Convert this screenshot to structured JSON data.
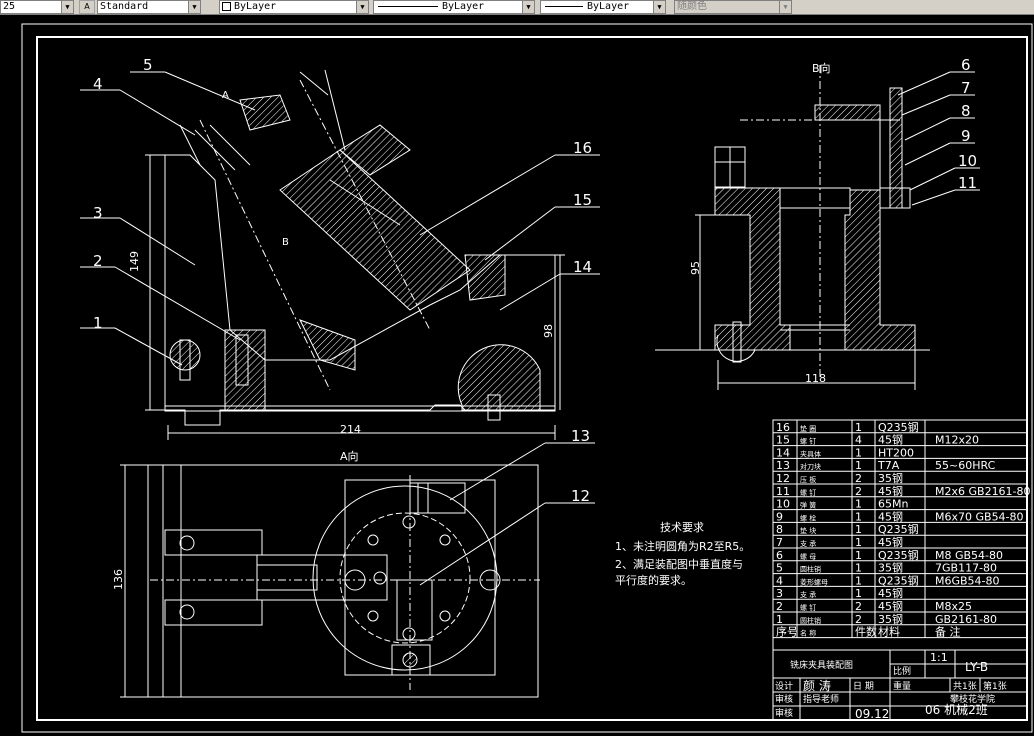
{
  "toolbar": {
    "textsize": "25",
    "textstyle": "Standard",
    "layer": "ByLayer",
    "linetype": "ByLayer",
    "lineweight": "ByLayer",
    "color": "随颜色"
  },
  "drawing": {
    "view_b_label": "B向",
    "view_a_label": "A向",
    "callout_a": "A",
    "callout_b": "B",
    "dims": {
      "left_height": "149",
      "right_height": "98",
      "base_width": "214",
      "side_height": "95",
      "side_width": "118",
      "plan_height": "136"
    },
    "balloons": [
      "1",
      "2",
      "3",
      "4",
      "5",
      "6",
      "7",
      "8",
      "9",
      "10",
      "11",
      "12",
      "13",
      "14",
      "15",
      "16"
    ],
    "tech_title": "技术要求",
    "tech_lines": [
      "1、未注明圆角为R2至R5。",
      "2、满足装配图中垂直度与",
      "平行度的要求。"
    ]
  },
  "bom": {
    "rows": [
      {
        "no": "16",
        "name": "垫  圈",
        "qty": "1",
        "mat": "Q235钢",
        "note": ""
      },
      {
        "no": "15",
        "name": "螺  钉",
        "qty": "4",
        "mat": "45钢",
        "note": "M12x20"
      },
      {
        "no": "14",
        "name": "夹具体",
        "qty": "1",
        "mat": "HT200",
        "note": ""
      },
      {
        "no": "13",
        "name": "对刀块",
        "qty": "1",
        "mat": "T7A",
        "note": "55~60HRC"
      },
      {
        "no": "12",
        "name": "压  板",
        "qty": "2",
        "mat": "35钢",
        "note": ""
      },
      {
        "no": "11",
        "name": "螺  钉",
        "qty": "2",
        "mat": "45钢",
        "note": "M2x6  GB2161-80"
      },
      {
        "no": "10",
        "name": "弹  簧",
        "qty": "1",
        "mat": "65Mn",
        "note": ""
      },
      {
        "no": "9",
        "name": "螺  栓",
        "qty": "1",
        "mat": "45钢",
        "note": "M6x70  GB54-80"
      },
      {
        "no": "8",
        "name": "垫  块",
        "qty": "1",
        "mat": "Q235钢",
        "note": ""
      },
      {
        "no": "7",
        "name": "支  承",
        "qty": "1",
        "mat": "45钢",
        "note": ""
      },
      {
        "no": "6",
        "name": "螺  母",
        "qty": "1",
        "mat": "Q235钢",
        "note": "M8  GB54-80"
      },
      {
        "no": "5",
        "name": "圆柱销",
        "qty": "1",
        "mat": "35钢",
        "note": "7GB117-80"
      },
      {
        "no": "4",
        "name": "菱形螺母",
        "qty": "1",
        "mat": "Q235钢",
        "note": "M6GB54-80"
      },
      {
        "no": "3",
        "name": "支  承",
        "qty": "1",
        "mat": "45钢",
        "note": ""
      },
      {
        "no": "2",
        "name": "螺  钉",
        "qty": "2",
        "mat": "45钢",
        "note": "M8x25"
      },
      {
        "no": "1",
        "name": "圆柱销",
        "qty": "2",
        "mat": "35钢",
        "note": "GB2161-80"
      }
    ],
    "header": {
      "no": "序号",
      "name": "名  称",
      "qty": "件数",
      "mat": "材料",
      "note": "备  注"
    }
  },
  "titleblock": {
    "name": "铣床夹具装配图",
    "scale_label": "比例",
    "scale": "1:1",
    "drawing_no": "LY-B",
    "weight_label": "重量",
    "designer_label": "设计",
    "designer": "颜  涛",
    "date_label": "日  期",
    "date": "09.12",
    "sheet_label": "共1张",
    "sheet2_label": "第1张",
    "check_label": "审核",
    "teacher_label": "指导老师",
    "school": "攀枝花学院",
    "class": "06 机械2班",
    "approve_label": "审核"
  }
}
